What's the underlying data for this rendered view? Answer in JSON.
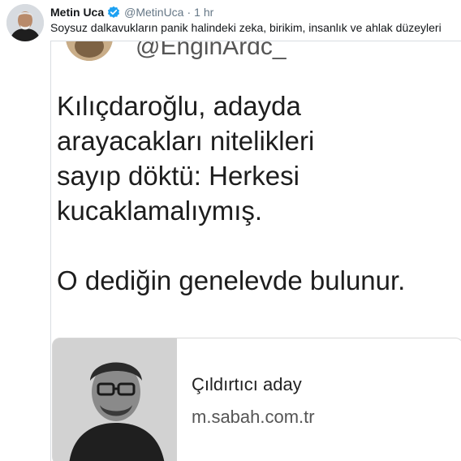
{
  "tweet": {
    "author_name": "Metin Uca",
    "handle": "@MetinUca",
    "separator": "·",
    "time": "1 hr",
    "text": "Soysuz dalkavukların panik halindeki zeka,  birikim, insanlık ve ahlak düzeyleri",
    "icons": {
      "avatar": "profile-photo",
      "verified": "verified-badge-icon"
    },
    "colors": {
      "verified": "#1da1f2",
      "text": "#14171a",
      "muted": "#657786"
    }
  },
  "quoted_image": {
    "handle": "@EnginArdc_",
    "lines": [
      "Kılıçdaroğlu, adayda",
      "arayacakları nitelikleri",
      "sayıp döktü: Herkesi",
      "kucaklamalıymış.",
      "O dediğin genelevde bulunur."
    ],
    "link_card": {
      "title": "Çıldırtıcı aday",
      "url": "m.sabah.com.tr"
    }
  }
}
